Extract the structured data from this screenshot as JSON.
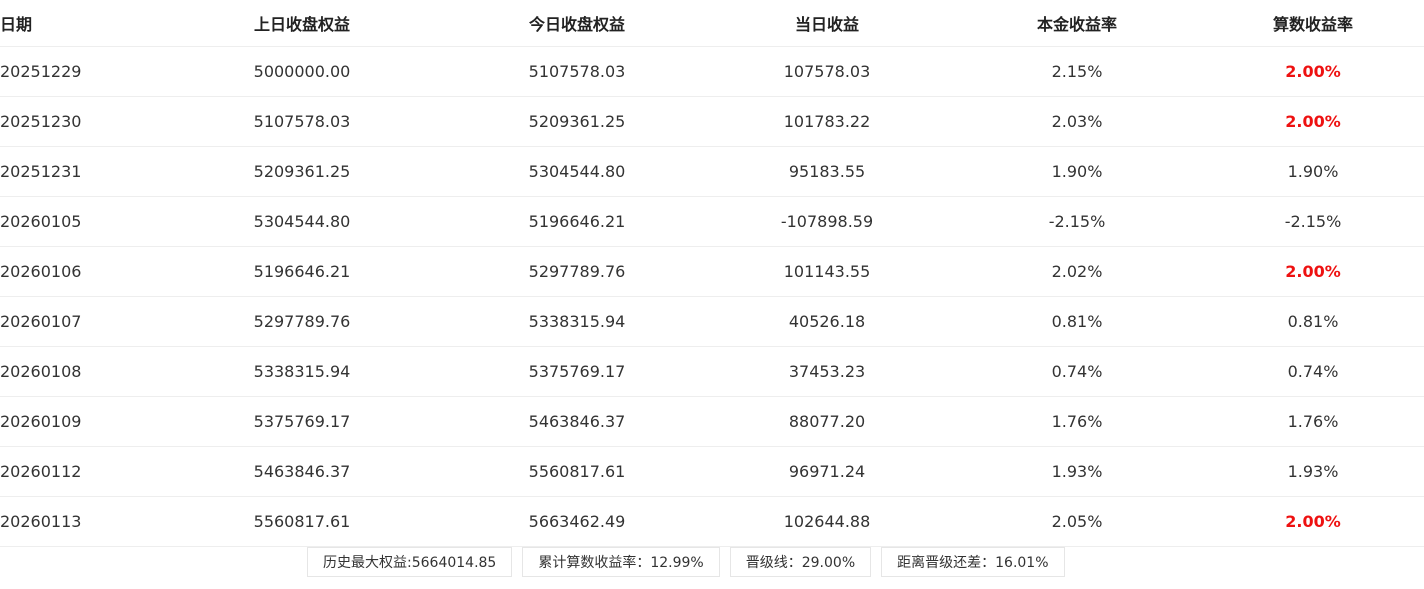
{
  "columns": {
    "date": "日期",
    "prev_equity": "上日收盘权益",
    "today_equity": "今日收盘权益",
    "daily_profit": "当日收益",
    "principal_rate": "本金收益率",
    "count_rate": "算数收益率"
  },
  "rows": [
    {
      "date": "20251229",
      "prev_equity": "5000000.00",
      "today_equity": "5107578.03",
      "daily_profit": "107578.03",
      "principal_rate": "2.15%",
      "count_rate": "2.00%",
      "count_rate_capped": true
    },
    {
      "date": "20251230",
      "prev_equity": "5107578.03",
      "today_equity": "5209361.25",
      "daily_profit": "101783.22",
      "principal_rate": "2.03%",
      "count_rate": "2.00%",
      "count_rate_capped": true
    },
    {
      "date": "20251231",
      "prev_equity": "5209361.25",
      "today_equity": "5304544.80",
      "daily_profit": "95183.55",
      "principal_rate": "1.90%",
      "count_rate": "1.90%",
      "count_rate_capped": false
    },
    {
      "date": "20260105",
      "prev_equity": "5304544.80",
      "today_equity": "5196646.21",
      "daily_profit": "-107898.59",
      "principal_rate": "-2.15%",
      "count_rate": "-2.15%",
      "count_rate_capped": false
    },
    {
      "date": "20260106",
      "prev_equity": "5196646.21",
      "today_equity": "5297789.76",
      "daily_profit": "101143.55",
      "principal_rate": "2.02%",
      "count_rate": "2.00%",
      "count_rate_capped": true
    },
    {
      "date": "20260107",
      "prev_equity": "5297789.76",
      "today_equity": "5338315.94",
      "daily_profit": "40526.18",
      "principal_rate": "0.81%",
      "count_rate": "0.81%",
      "count_rate_capped": false
    },
    {
      "date": "20260108",
      "prev_equity": "5338315.94",
      "today_equity": "5375769.17",
      "daily_profit": "37453.23",
      "principal_rate": "0.74%",
      "count_rate": "0.74%",
      "count_rate_capped": false
    },
    {
      "date": "20260109",
      "prev_equity": "5375769.17",
      "today_equity": "5463846.37",
      "daily_profit": "88077.20",
      "principal_rate": "1.76%",
      "count_rate": "1.76%",
      "count_rate_capped": false
    },
    {
      "date": "20260112",
      "prev_equity": "5463846.37",
      "today_equity": "5560817.61",
      "daily_profit": "96971.24",
      "principal_rate": "1.93%",
      "count_rate": "1.93%",
      "count_rate_capped": false
    },
    {
      "date": "20260113",
      "prev_equity": "5560817.61",
      "today_equity": "5663462.49",
      "daily_profit": "102644.88",
      "principal_rate": "2.05%",
      "count_rate": "2.00%",
      "count_rate_capped": true
    }
  ],
  "summary": {
    "max_equity": "历史最大权益:5664014.85",
    "cumulative_rate": "累计算数收益率：12.99%",
    "promotion_line": "晋级线：29.00%",
    "gap_to_promotion": "距离晋级还差：16.01%"
  },
  "colors": {
    "highlight": "#ee1111",
    "text": "#333333",
    "divider": "#eeeeee"
  }
}
